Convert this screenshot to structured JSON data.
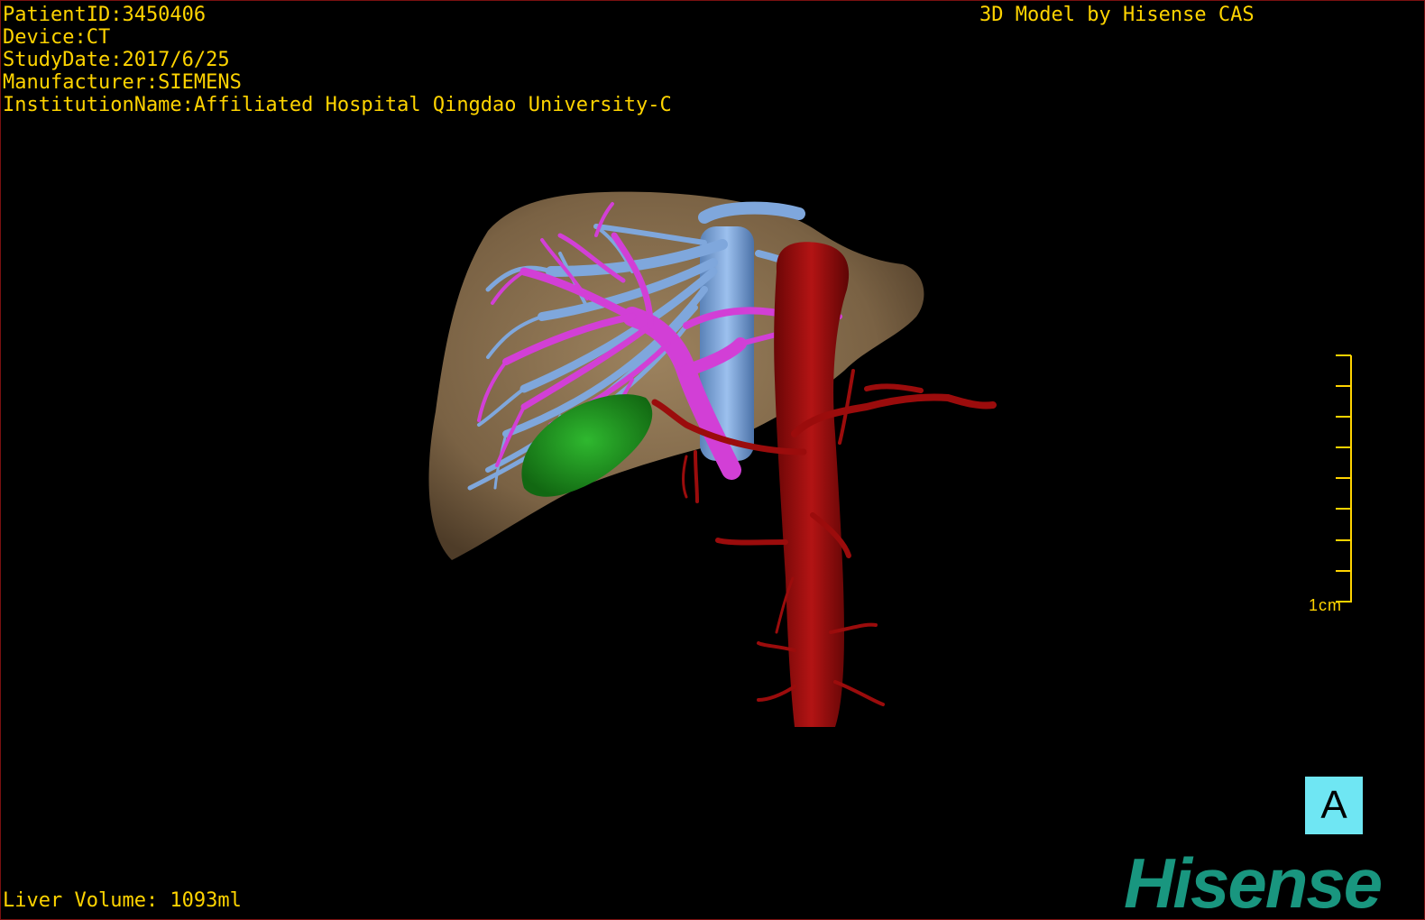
{
  "overlay": {
    "patient_id": "PatientID:3450406",
    "device": "Device:CT",
    "study_date": "StudyDate:2017/6/25",
    "manufacturer": "Manufacturer:SIEMENS",
    "institution": "InstitutionName:Affiliated Hospital Qingdao University-C",
    "model_credit": "3D Model by Hisense CAS",
    "liver_volume": "Liver Volume: 1093ml"
  },
  "scale_bar": {
    "label": "1cm"
  },
  "orientation_marker": {
    "label": "A",
    "color": "#6fe6f3"
  },
  "logo": {
    "text": "Hisense",
    "color": "#19967f"
  },
  "colors": {
    "text": "#ffd400",
    "liver": "#8a7150",
    "hepatic_vein": "#7fa7dc",
    "portal_vein": "#d23fd6",
    "artery": "#9b0c0c",
    "tumor": "#1f9a1f",
    "viewport_border": "#7a1010"
  }
}
